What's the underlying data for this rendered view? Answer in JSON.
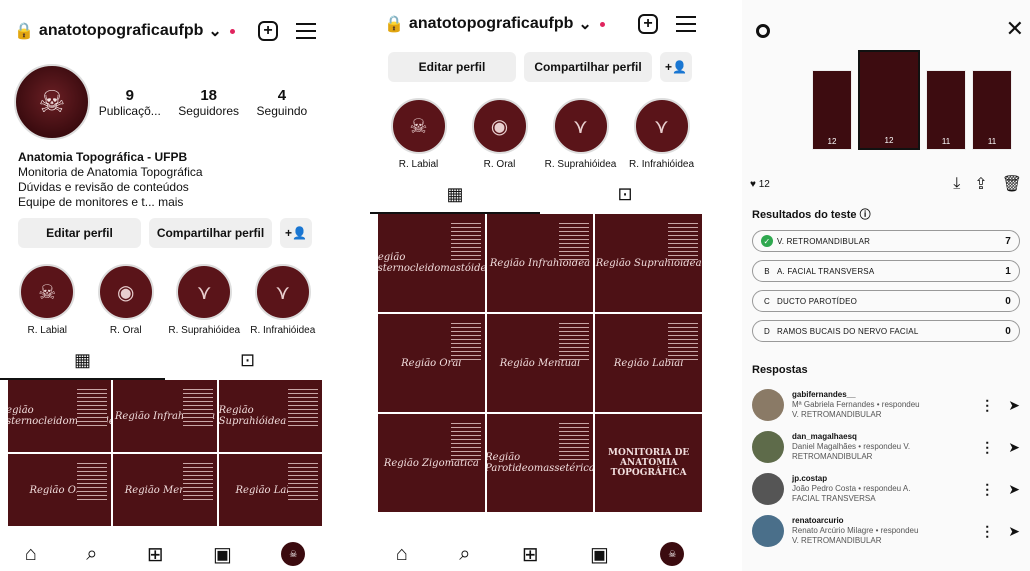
{
  "profile": {
    "username": "anatotopograficaufpb",
    "stats": [
      {
        "value": "9",
        "label": "Publicaçõ..."
      },
      {
        "value": "18",
        "label": "Seguidores"
      },
      {
        "value": "4",
        "label": "Seguindo"
      }
    ],
    "bio_name": "Anatomia Topográfica - UFPB",
    "bio_lines": [
      "Monitoria de Anatomia Topográfica",
      "Dúvidas e revisão de conteúdos",
      "Equipe de monitores e t... mais"
    ],
    "edit_label": "Editar perfil",
    "share_label": "Compartilhar perfil",
    "highlights": [
      "R. Labial",
      "R. Oral",
      "R. Suprahióidea",
      "R. Infrahióidea"
    ],
    "grid_titles": [
      "Região Esternocleidomastóidea",
      "Região Infrahióidea",
      "Região Suprahióidea",
      "Região Oral",
      "Região Mentual",
      "Região Labial",
      "Região Zigomática",
      "Região Parotideomassetérica",
      "MONITORIA DE ANATOMIA TOPOGRÁFICA"
    ]
  },
  "story": {
    "views": "12",
    "thumb_counts": [
      "12",
      "12",
      "11",
      "11"
    ],
    "results_title": "Resultados do teste",
    "options": [
      {
        "text": "V. RETROMANDIBULAR",
        "count": "7",
        "mark": "✓"
      },
      {
        "text": "A. FACIAL TRANSVERSA",
        "count": "1",
        "mark": "B"
      },
      {
        "text": "DUCTO PAROTÍDEO",
        "count": "0",
        "mark": "C"
      },
      {
        "text": "RAMOS BUCAIS DO NERVO FACIAL",
        "count": "0",
        "mark": "D"
      }
    ],
    "responses_title": "Respostas",
    "responses": [
      {
        "user": "gabifernandes__",
        "line1": "Mª Gabriela Fernandes • respondeu",
        "line2": "V. RETROMANDIBULAR"
      },
      {
        "user": "dan_magalhaesq",
        "line1": "Daniel Magalhães • respondeu V.",
        "line2": "RETROMANDIBULAR"
      },
      {
        "user": "jp.costap",
        "line1": "João Pedro Costa • respondeu A.",
        "line2": "FACIAL TRANSVERSA"
      },
      {
        "user": "renatoarcurio",
        "line1": "Renato Arcúrio Milagre • respondeu",
        "line2": "V. RETROMANDIBULAR"
      }
    ]
  }
}
